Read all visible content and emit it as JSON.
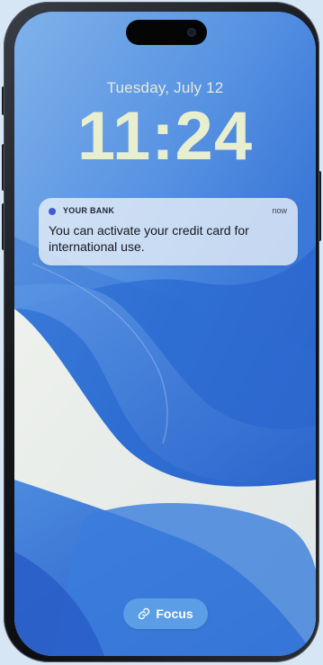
{
  "lock_screen": {
    "date": "Tuesday, July 12",
    "time": "11:24"
  },
  "notification": {
    "app_name": "YOUR BANK",
    "timestamp": "now",
    "message": "You can activate your credit card for international use.",
    "app_color": "#3e5bd8"
  },
  "focus": {
    "label": "Focus",
    "icon": "link-icon"
  },
  "colors": {
    "wallpaper_base": "#2b73d6",
    "clock_text": "#e8efcf",
    "focus_pill": "#5b9ee6"
  }
}
